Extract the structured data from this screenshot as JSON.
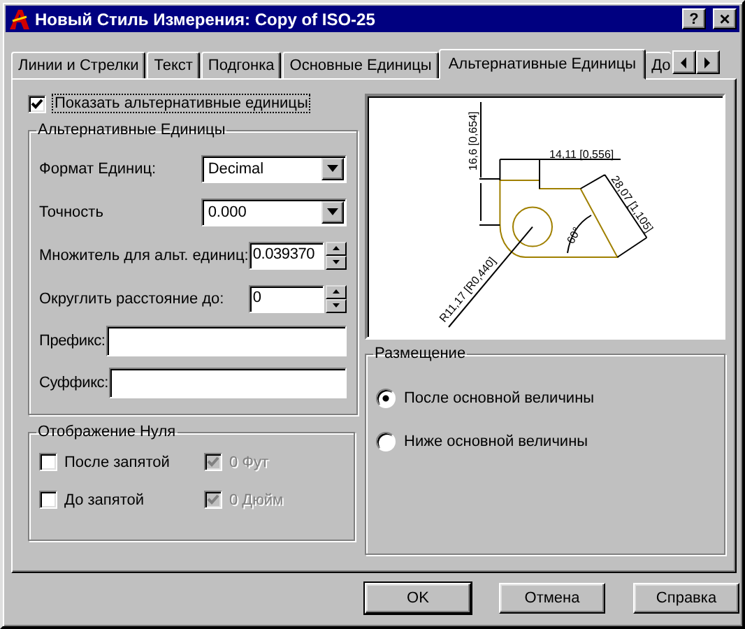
{
  "window": {
    "title": "Новый Стиль Измерения: Copy of ISO-25",
    "help_button": "?",
    "close_button": "×"
  },
  "tabs": [
    {
      "label": "Линии и Стрелки",
      "selected": false
    },
    {
      "label": "Текст",
      "selected": false
    },
    {
      "label": "Подгонка",
      "selected": false
    },
    {
      "label": "Основные Единицы",
      "selected": false
    },
    {
      "label": "Альтернативные Единицы",
      "selected": true
    },
    {
      "label": "До",
      "selected": false
    }
  ],
  "show_alt_units": {
    "label": "Показать альтернативные единицы",
    "checked": true
  },
  "alt_units": {
    "title": "Альтернативные Единицы",
    "fields": [
      {
        "kind": "dropdown",
        "label": "Формат Единиц:",
        "value": "Decimal"
      },
      {
        "kind": "dropdown",
        "label": "Точность",
        "value": "0.000"
      },
      {
        "kind": "spinner",
        "label": "Множитель для альт. единиц:",
        "value": "0.039370"
      },
      {
        "kind": "spinner",
        "label": "Округлить расстояние до:",
        "value": "0"
      },
      {
        "kind": "text",
        "label": "Префикс:"
      },
      {
        "kind": "text",
        "label": "Суффикс:"
      }
    ]
  },
  "zero_display": {
    "title": "Отображение Нуля",
    "options": [
      {
        "label": "После запятой",
        "checked": false,
        "disabled": false
      },
      {
        "label": "0 Фут",
        "checked": true,
        "disabled": true
      },
      {
        "label": "До запятой",
        "checked": false,
        "disabled": false
      },
      {
        "label": "0 Дюйм",
        "checked": true,
        "disabled": true
      }
    ]
  },
  "preview": {
    "labels": [
      "16,6 [0,654]",
      "14,11 [0,556]",
      "28,07 [1,105]",
      "60°",
      "R11,17 [R0,440]"
    ]
  },
  "placement": {
    "title": "Размещение",
    "options": [
      {
        "label": "После основной величины",
        "selected": true
      },
      {
        "label": "Ниже основной величины",
        "selected": false
      }
    ]
  },
  "buttons": [
    "OK",
    "Отмена",
    "Справка"
  ]
}
